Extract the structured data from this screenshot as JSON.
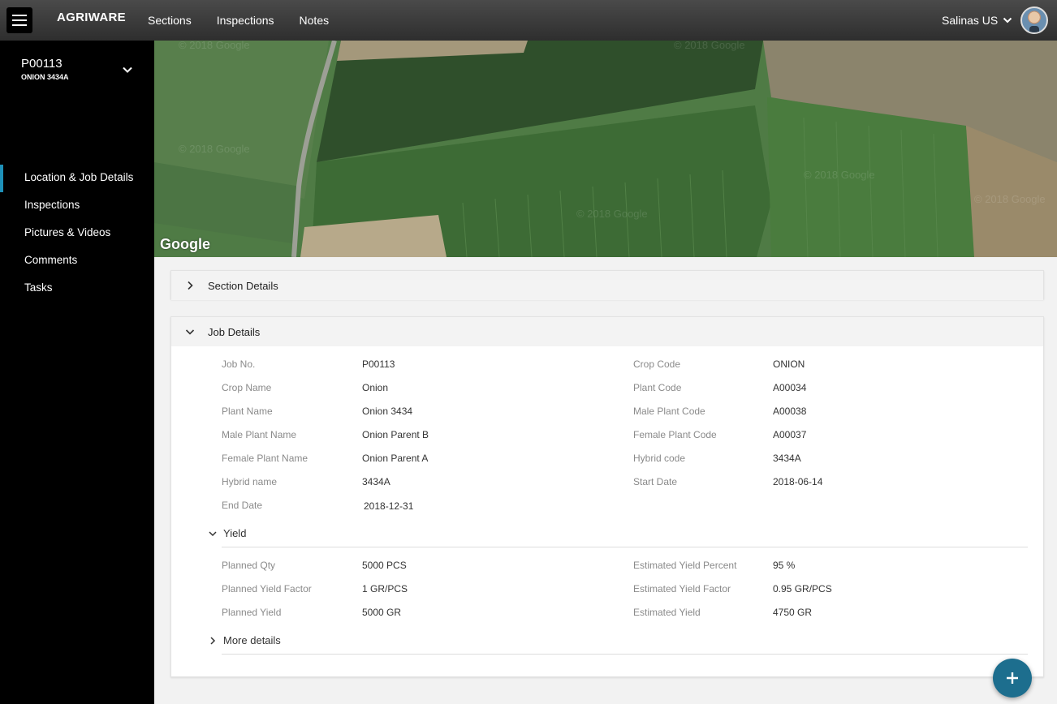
{
  "topbar": {
    "brand": "AGRIWARE",
    "nav": [
      "Sections",
      "Inspections",
      "Notes"
    ],
    "location": "Salinas US"
  },
  "sidebar": {
    "job_id": "P00113",
    "job_sub": "ONION 3434A",
    "items": [
      "Location & Job Details",
      "Inspections",
      "Pictures & Videos",
      "Comments",
      "Tasks"
    ]
  },
  "map": {
    "attribution": "Google",
    "watermark": "© 2018 Google"
  },
  "section_details": {
    "title": "Section Details"
  },
  "job_details": {
    "title": "Job Details",
    "fields_left": [
      {
        "label": "Job No.",
        "value": "P00113"
      },
      {
        "label": "Crop Name",
        "value": "Onion"
      },
      {
        "label": "Plant Name",
        "value": "Onion 3434"
      },
      {
        "label": "Male Plant Name",
        "value": "Onion Parent B"
      },
      {
        "label": "Female Plant Name",
        "value": "Onion Parent A"
      },
      {
        "label": "Hybrid name",
        "value": "3434A"
      },
      {
        "label": "End Date",
        "value": "2018-12-31"
      }
    ],
    "fields_right": [
      {
        "label": "Crop Code",
        "value": "ONION"
      },
      {
        "label": "Plant Code",
        "value": "A00034"
      },
      {
        "label": "Male Plant Code",
        "value": "A00038"
      },
      {
        "label": "Female Plant Code",
        "value": "A00037"
      },
      {
        "label": "Hybrid code",
        "value": "3434A"
      },
      {
        "label": "Start Date",
        "value": "2018-06-14"
      }
    ],
    "yield": {
      "title": "Yield",
      "fields_left": [
        {
          "label": "Planned Qty",
          "value": "5000 PCS"
        },
        {
          "label": "Planned Yield Factor",
          "value": "1 GR/PCS"
        },
        {
          "label": "Planned Yield",
          "value": "5000 GR"
        }
      ],
      "fields_right": [
        {
          "label": "Estimated Yield Percent",
          "value": "95 %"
        },
        {
          "label": "Estimated Yield Factor",
          "value": "0.95 GR/PCS"
        },
        {
          "label": "Estimated Yield",
          "value": "4750 GR"
        }
      ]
    },
    "more_details": {
      "title": "More details"
    }
  },
  "colors": {
    "accent": "#1e90b8",
    "fab": "#1d6e8e",
    "sidebar_bg": "#000000"
  }
}
